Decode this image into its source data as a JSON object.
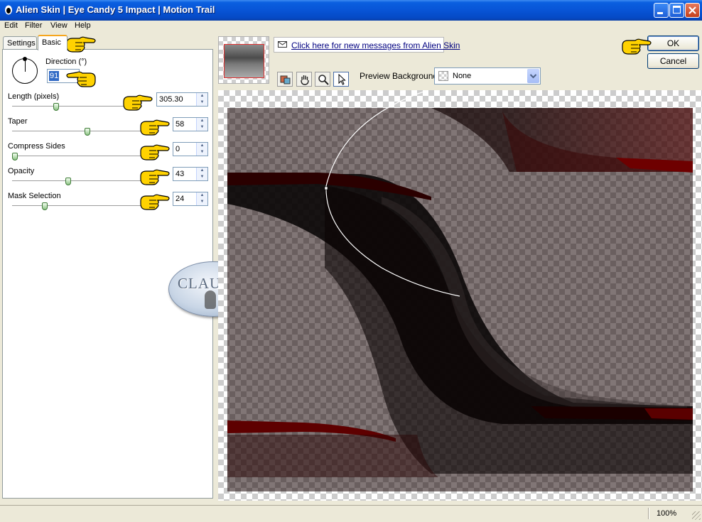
{
  "window": {
    "title": "Alien Skin | Eye Candy 5 Impact | Motion Trail",
    "controls": [
      "minimize-icon",
      "maximize-icon",
      "close-icon"
    ]
  },
  "menu": {
    "items": [
      "Edit",
      "Filter",
      "View",
      "Help"
    ]
  },
  "tabs": [
    {
      "label": "Settings",
      "active": false
    },
    {
      "label": "Basic",
      "active": true
    }
  ],
  "params": {
    "direction": {
      "label": "Direction (°)",
      "value": "91"
    },
    "length": {
      "label": "Length (pixels)",
      "value": "305.30",
      "level": 0.33
    },
    "taper": {
      "label": "Taper",
      "value": "58",
      "level": 0.58
    },
    "compress": {
      "label": "Compress Sides",
      "value": "0",
      "level": 0.0
    },
    "opacity": {
      "label": "Opacity",
      "value": "43",
      "level": 0.43
    },
    "mask": {
      "label": "Mask Selection",
      "value": "24",
      "level": 0.24
    }
  },
  "messages": {
    "link": "Click here for new messages from Alien Skin",
    "icon": "envelope-icon"
  },
  "buttons": {
    "ok": "OK",
    "cancel": "Cancel"
  },
  "toolbar": {
    "tools": [
      "preview-toggle-icon",
      "hand-icon",
      "zoom-icon",
      "pointer-icon"
    ],
    "preview_background_label": "Preview Background:",
    "preview_background_value": "None"
  },
  "watermark": {
    "text": "CLAUDIA"
  },
  "status": {
    "zoom": "100%"
  },
  "colors": {
    "trail_dark": "#0a0505",
    "trail_red": "#6e0000",
    "titlebar": "#0854d6",
    "pointer_hand": "#ffd200"
  }
}
